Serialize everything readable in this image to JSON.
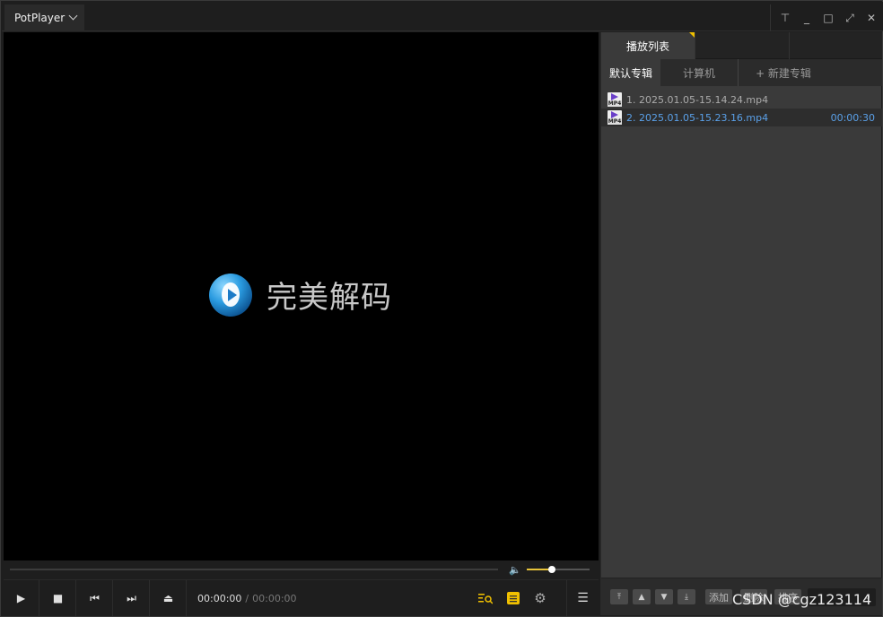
{
  "app": {
    "title": "PotPlayer"
  },
  "window_controls": {
    "pin": "⊤",
    "minimize": "_",
    "maximize": "□",
    "fullscreen": "⤢",
    "close": "✕"
  },
  "video": {
    "logo_text": "完美解码"
  },
  "volume": {
    "level": 0.4
  },
  "controls": {
    "play": "▶",
    "stop": "■",
    "prev": "⏮",
    "next": "⏭",
    "eject": "⏏",
    "time_current": "00:00:00",
    "time_sep": "/",
    "time_total": "00:00:00",
    "menu": "☰"
  },
  "panel": {
    "tab_playlist": "播放列表",
    "subtabs": {
      "default": "默认专辑",
      "computer": "计算机",
      "new_album": "+ 新建专辑"
    },
    "items": [
      {
        "index": "1.",
        "name": "2025.01.05-15.14.24.mp4",
        "duration": ""
      },
      {
        "index": "2.",
        "name": "2025.01.05-15.23.16.mp4",
        "duration": "00:00:30"
      }
    ],
    "bottom": {
      "add": "添加",
      "delete": "删除",
      "sort": "排序"
    }
  },
  "watermark": "CSDN @cgz123114"
}
